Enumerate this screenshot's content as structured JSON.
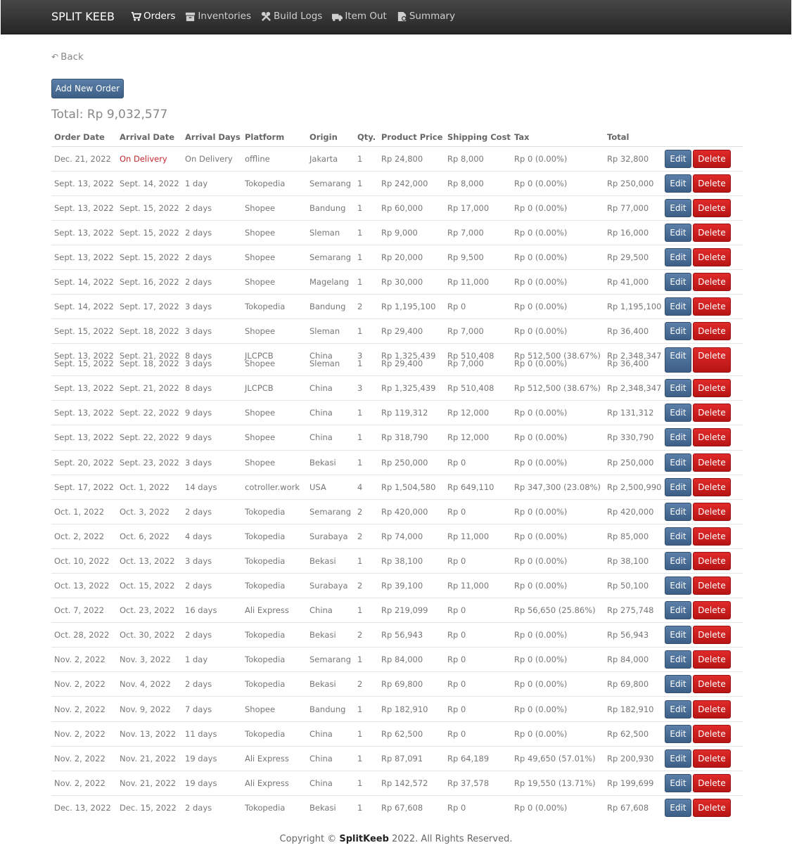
{
  "nav": {
    "brand": "SPLIT KEEB",
    "links": [
      {
        "label": "Orders",
        "icon": "cart-icon"
      },
      {
        "label": "Inventories",
        "icon": "box-icon"
      },
      {
        "label": "Build Logs",
        "icon": "tools-icon"
      },
      {
        "label": "Item Out",
        "icon": "truck-icon"
      },
      {
        "label": "Summary",
        "icon": "document-icon"
      }
    ]
  },
  "back_label": "Back",
  "add_label": "Add New Order",
  "total_label": "Total: Rp 9,032,577",
  "table": {
    "headers": [
      "Order Date",
      "Arrival Date",
      "Arrival Days",
      "Platform",
      "Origin",
      "Qty.",
      "Product Price",
      "Shipping Cost",
      "Tax",
      "Total"
    ],
    "edit_label": "Edit",
    "delete_label": "Delete",
    "rows": [
      [
        "Dec. 21, 2022",
        "On Delivery",
        "On Delivery",
        "offline",
        "Jakarta",
        "1",
        "Rp 24,800",
        "Rp 8,000",
        "Rp 0 (0.00%)",
        "Rp 32,800"
      ],
      [
        "Sept. 13, 2022",
        "Sept. 14, 2022",
        "1 day",
        "Tokopedia",
        "Semarang",
        "1",
        "Rp 242,000",
        "Rp 8,000",
        "Rp 0 (0.00%)",
        "Rp 250,000"
      ],
      [
        "Sept. 13, 2022",
        "Sept. 15, 2022",
        "2 days",
        "Shopee",
        "Bandung",
        "1",
        "Rp 60,000",
        "Rp 17,000",
        "Rp 0 (0.00%)",
        "Rp 77,000"
      ],
      [
        "Sept. 13, 2022",
        "Sept. 15, 2022",
        "2 days",
        "Shopee",
        "Sleman",
        "1",
        "Rp 9,000",
        "Rp 7,000",
        "Rp 0 (0.00%)",
        "Rp 16,000"
      ],
      [
        "Sept. 13, 2022",
        "Sept. 15, 2022",
        "2 days",
        "Shopee",
        "Semarang",
        "1",
        "Rp 20,000",
        "Rp 9,500",
        "Rp 0 (0.00%)",
        "Rp 29,500"
      ],
      [
        "Sept. 14, 2022",
        "Sept. 16, 2022",
        "2 days",
        "Shopee",
        "Magelang",
        "1",
        "Rp 30,000",
        "Rp 11,000",
        "Rp 0 (0.00%)",
        "Rp 41,000"
      ],
      [
        "Sept. 14, 2022",
        "Sept. 17, 2022",
        "3 days",
        "Tokopedia",
        "Bandung",
        "2",
        "Rp 1,195,100",
        "Rp 0",
        "Rp 0 (0.00%)",
        "Rp 1,195,100"
      ],
      [
        "Sept. 15, 2022",
        "Sept. 18, 2022",
        "3 days",
        "Shopee",
        "Sleman",
        "1",
        "Rp 29,400",
        "Rp 7,000",
        "Rp 0 (0.00%)",
        "Rp 36,400"
      ],
      [
        "Sept. 13, 2022",
        "Sept. 21, 2022",
        "8 days",
        "JLCPCB",
        "China",
        "3",
        "Rp 1,325,439",
        "Rp 510,408",
        "Rp 512,500 (38.67%)",
        "Rp 2,348,347"
      ],
      [
        "Sept. 13, 2022",
        "Sept. 21, 2022",
        "8 days",
        "JLCPCB",
        "China",
        "3",
        "Rp 1,325,439",
        "Rp 510,408",
        "Rp 512,500 (38.67%)",
        "Rp 2,348,347"
      ],
      [
        "Sept. 13, 2022",
        "Sept. 22, 2022",
        "9 days",
        "Shopee",
        "China",
        "1",
        "Rp 119,312",
        "Rp 12,000",
        "Rp 0 (0.00%)",
        "Rp 131,312"
      ],
      [
        "Sept. 13, 2022",
        "Sept. 22, 2022",
        "9 days",
        "Shopee",
        "China",
        "1",
        "Rp 318,790",
        "Rp 12,000",
        "Rp 0 (0.00%)",
        "Rp 330,790"
      ],
      [
        "Sept. 20, 2022",
        "Sept. 23, 2022",
        "3 days",
        "Shopee",
        "Bekasi",
        "1",
        "Rp 250,000",
        "Rp 0",
        "Rp 0 (0.00%)",
        "Rp 250,000"
      ],
      [
        "Sept. 17, 2022",
        "Oct. 1, 2022",
        "14 days",
        "cotroller.work",
        "USA",
        "4",
        "Rp 1,504,580",
        "Rp 649,110",
        "Rp 347,300 (23.08%)",
        "Rp 2,500,990"
      ],
      [
        "Oct. 1, 2022",
        "Oct. 3, 2022",
        "2 days",
        "Tokopedia",
        "Semarang",
        "2",
        "Rp 420,000",
        "Rp 0",
        "Rp 0 (0.00%)",
        "Rp 420,000"
      ],
      [
        "Oct. 2, 2022",
        "Oct. 6, 2022",
        "4 days",
        "Tokopedia",
        "Surabaya",
        "2",
        "Rp 74,000",
        "Rp 11,000",
        "Rp 0 (0.00%)",
        "Rp 85,000"
      ],
      [
        "Oct. 10, 2022",
        "Oct. 13, 2022",
        "3 days",
        "Tokopedia",
        "Bekasi",
        "1",
        "Rp 38,100",
        "Rp 0",
        "Rp 0 (0.00%)",
        "Rp 38,100"
      ],
      [
        "Oct. 13, 2022",
        "Oct. 15, 2022",
        "2 days",
        "Tokopedia",
        "Surabaya",
        "2",
        "Rp 39,100",
        "Rp 11,000",
        "Rp 0 (0.00%)",
        "Rp 50,100"
      ],
      [
        "Oct. 7, 2022",
        "Oct. 23, 2022",
        "16 days",
        "Ali Express",
        "China",
        "1",
        "Rp 219,099",
        "Rp 0",
        "Rp 56,650 (25.86%)",
        "Rp 275,748"
      ],
      [
        "Oct. 28, 2022",
        "Oct. 30, 2022",
        "2 days",
        "Tokopedia",
        "Bekasi",
        "2",
        "Rp 56,943",
        "Rp 0",
        "Rp 0 (0.00%)",
        "Rp 56,943"
      ],
      [
        "Nov. 2, 2022",
        "Nov. 3, 2022",
        "1 day",
        "Tokopedia",
        "Semarang",
        "1",
        "Rp 84,000",
        "Rp 0",
        "Rp 0 (0.00%)",
        "Rp 84,000"
      ],
      [
        "Nov. 2, 2022",
        "Nov. 4, 2022",
        "2 days",
        "Tokopedia",
        "Bekasi",
        "2",
        "Rp 69,800",
        "Rp 0",
        "Rp 0 (0.00%)",
        "Rp 69,800"
      ],
      [
        "Nov. 2, 2022",
        "Nov. 9, 2022",
        "7 days",
        "Shopee",
        "Bandung",
        "1",
        "Rp 182,910",
        "Rp 0",
        "Rp 0 (0.00%)",
        "Rp 182,910"
      ],
      [
        "Nov. 2, 2022",
        "Nov. 13, 2022",
        "11 days",
        "Tokopedia",
        "China",
        "1",
        "Rp 62,500",
        "Rp 0",
        "Rp 0 (0.00%)",
        "Rp 62,500"
      ],
      [
        "Nov. 2, 2022",
        "Nov. 21, 2022",
        "19 days",
        "Ali Express",
        "China",
        "1",
        "Rp 87,091",
        "Rp 64,189",
        "Rp 49,650 (57.01%)",
        "Rp 200,930"
      ],
      [
        "Nov. 2, 2022",
        "Nov. 21, 2022",
        "19 days",
        "Ali Express",
        "China",
        "1",
        "Rp 142,572",
        "Rp 37,578",
        "Rp 19,550 (13.71%)",
        "Rp 199,699"
      ],
      [
        "Dec. 13, 2022",
        "Dec. 15, 2022",
        "2 days",
        "Tokopedia",
        "Bekasi",
        "1",
        "Rp 67,608",
        "Rp 0",
        "Rp 0 (0.00%)",
        "Rp 67,608"
      ]
    ],
    "overlap_row_index": 8,
    "overlap_under": [
      "Sept. 15, 2022",
      "Sept. 18, 2022",
      "3 days",
      "Shopee",
      "Sleman",
      "1",
      "Rp 29,400",
      "Rp 7,000",
      "Rp 0 (0.00%)",
      "Rp 36,400"
    ]
  },
  "footer": {
    "prefix": "Copyright ©",
    "brand": "SplitKeeb",
    "suffix": "2022. All Rights Reserved."
  }
}
